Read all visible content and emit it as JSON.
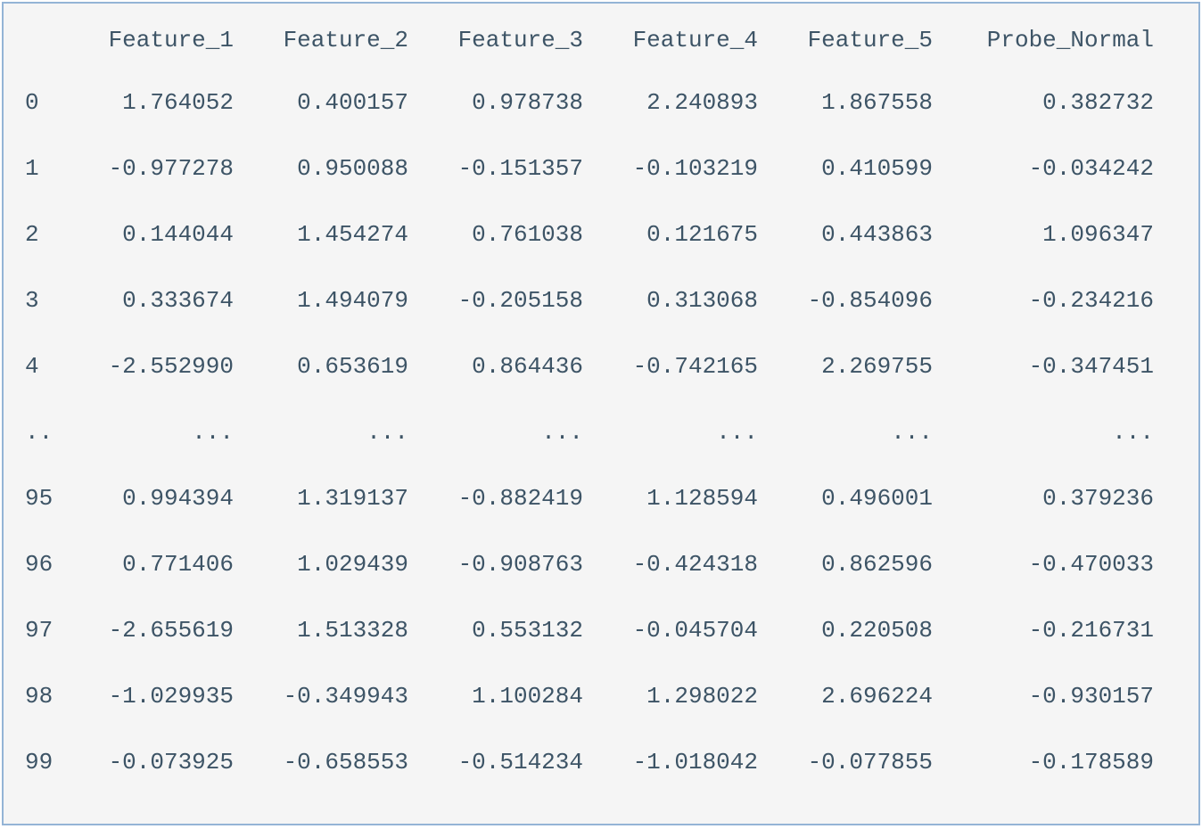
{
  "columns": [
    "Feature_1",
    "Feature_2",
    "Feature_3",
    "Feature_4",
    "Feature_5",
    "Probe_Normal"
  ],
  "index_ellipsis": "..",
  "value_ellipsis": "...",
  "rows_top": [
    {
      "idx": "0",
      "vals": [
        "1.764052",
        "0.400157",
        "0.978738",
        "2.240893",
        "1.867558",
        "0.382732"
      ]
    },
    {
      "idx": "1",
      "vals": [
        "-0.977278",
        "0.950088",
        "-0.151357",
        "-0.103219",
        "0.410599",
        "-0.034242"
      ]
    },
    {
      "idx": "2",
      "vals": [
        "0.144044",
        "1.454274",
        "0.761038",
        "0.121675",
        "0.443863",
        "1.096347"
      ]
    },
    {
      "idx": "3",
      "vals": [
        "0.333674",
        "1.494079",
        "-0.205158",
        "0.313068",
        "-0.854096",
        "-0.234216"
      ]
    },
    {
      "idx": "4",
      "vals": [
        "-2.552990",
        "0.653619",
        "0.864436",
        "-0.742165",
        "2.269755",
        "-0.347451"
      ]
    }
  ],
  "rows_bottom": [
    {
      "idx": "95",
      "vals": [
        "0.994394",
        "1.319137",
        "-0.882419",
        "1.128594",
        "0.496001",
        "0.379236"
      ]
    },
    {
      "idx": "96",
      "vals": [
        "0.771406",
        "1.029439",
        "-0.908763",
        "-0.424318",
        "0.862596",
        "-0.470033"
      ]
    },
    {
      "idx": "97",
      "vals": [
        "-2.655619",
        "1.513328",
        "0.553132",
        "-0.045704",
        "0.220508",
        "-0.216731"
      ]
    },
    {
      "idx": "98",
      "vals": [
        "-1.029935",
        "-0.349943",
        "1.100284",
        "1.298022",
        "2.696224",
        "-0.930157"
      ]
    },
    {
      "idx": "99",
      "vals": [
        "-0.073925",
        "-0.658553",
        "-0.514234",
        "-1.018042",
        "-0.077855",
        "-0.178589"
      ]
    }
  ]
}
